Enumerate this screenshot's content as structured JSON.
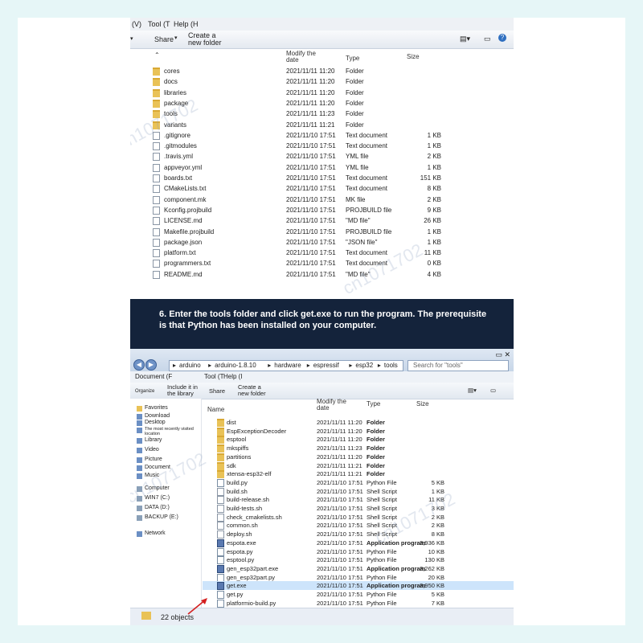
{
  "top_window": {
    "menu": [
      "(V)",
      "Tool (T",
      "Help (H"
    ],
    "toolbar": {
      "share": "Share",
      "new_folder": "Create a new folder"
    },
    "columns": {
      "modify": "Modify the date",
      "type": "Type",
      "size": "Size"
    },
    "files": [
      {
        "name": "cores",
        "date": "2021/11/11 11:20",
        "type": "Folder",
        "size": "",
        "icon": "folder"
      },
      {
        "name": "docs",
        "date": "2021/11/11 11:20",
        "type": "Folder",
        "size": "",
        "icon": "folder"
      },
      {
        "name": "libraries",
        "date": "2021/11/11 11:20",
        "type": "Folder",
        "size": "",
        "icon": "folder"
      },
      {
        "name": "package",
        "date": "2021/11/11 11:20",
        "type": "Folder",
        "size": "",
        "icon": "folder"
      },
      {
        "name": "tools",
        "date": "2021/11/11 11:23",
        "type": "Folder",
        "size": "",
        "icon": "folder"
      },
      {
        "name": "variants",
        "date": "2021/11/11 11:21",
        "type": "Folder",
        "size": "",
        "icon": "folder"
      },
      {
        "name": ".gitignore",
        "date": "2021/11/10 17:51",
        "type": "Text document",
        "size": "1 KB",
        "icon": "file"
      },
      {
        "name": ".gitmodules",
        "date": "2021/11/10 17:51",
        "type": "Text document",
        "size": "1 KB",
        "icon": "file"
      },
      {
        "name": ".travis.yml",
        "date": "2021/11/10 17:51",
        "type": "YML file",
        "size": "2 KB",
        "icon": "file"
      },
      {
        "name": "appveyor.yml",
        "date": "2021/11/10 17:51",
        "type": "YML file",
        "size": "1 KB",
        "icon": "file"
      },
      {
        "name": "boards.txt",
        "date": "2021/11/10 17:51",
        "type": "Text document",
        "size": "151 KB",
        "icon": "file"
      },
      {
        "name": "CMakeLists.txt",
        "date": "2021/11/10 17:51",
        "type": "Text document",
        "size": "8 KB",
        "icon": "file"
      },
      {
        "name": "component.mk",
        "date": "2021/11/10 17:51",
        "type": "MK file",
        "size": "2 KB",
        "icon": "file"
      },
      {
        "name": "Kconfig.projbuild",
        "date": "2021/11/10 17:51",
        "type": "PROJBUILD file",
        "size": "9 KB",
        "icon": "file"
      },
      {
        "name": "LICENSE.md",
        "date": "2021/11/10 17:51",
        "type": "\"MD file\"",
        "size": "26 KB",
        "icon": "file"
      },
      {
        "name": "Makefile.projbuild",
        "date": "2021/11/10 17:51",
        "type": "PROJBUILD file",
        "size": "1 KB",
        "icon": "file"
      },
      {
        "name": "package.json",
        "date": "2021/11/10 17:51",
        "type": "\"JSON file\"",
        "size": "1 KB",
        "icon": "file"
      },
      {
        "name": "platform.txt",
        "date": "2021/11/10 17:51",
        "type": "Text document",
        "size": "11 KB",
        "icon": "file"
      },
      {
        "name": "programmers.txt",
        "date": "2021/11/10 17:51",
        "type": "Text document",
        "size": "0 KB",
        "icon": "file"
      },
      {
        "name": "README.md",
        "date": "2021/11/10 17:51",
        "type": "\"MD file\"",
        "size": "4 KB",
        "icon": "file"
      }
    ]
  },
  "banner": {
    "text": "6. Enter the tools folder and click get.exe to run the program. The prerequisite is that Python has been installed on your computer."
  },
  "bottom_window": {
    "path": [
      "arduino",
      "arduino-1.8.10",
      "hardware",
      "espressif",
      "esp32",
      "tools"
    ],
    "search_placeholder": "Search for \"tools\"",
    "menu": [
      "Document (F",
      "Tool (T",
      "Help (I"
    ],
    "toolbar": {
      "organize": "Organize",
      "include": "Include it in the library",
      "share": "Share",
      "new_folder": "Create a new folder"
    },
    "columns": {
      "name": "Name",
      "modify": "Modify the date",
      "type": "Type",
      "size": "Size"
    },
    "nav": [
      "Favorites",
      "Download",
      "Desktop",
      "The most recently visited location",
      "Library",
      "Video",
      "Picture",
      "Document",
      "Music",
      "Computer",
      "WIN7 (C:)",
      "DATA (D:)",
      "BACKUP (E:)",
      "Network"
    ],
    "files": [
      {
        "name": "dist",
        "date": "2021/11/11 11:20",
        "type": "Folder",
        "size": "",
        "icon": "folder"
      },
      {
        "name": "EspExceptionDecoder",
        "date": "2021/11/11 11:20",
        "type": "Folder",
        "size": "",
        "icon": "folder"
      },
      {
        "name": "esptool",
        "date": "2021/11/11 11:20",
        "type": "Folder",
        "size": "",
        "icon": "folder"
      },
      {
        "name": "mkspiffs",
        "date": "2021/11/11 11:23",
        "type": "Folder",
        "size": "",
        "icon": "folder"
      },
      {
        "name": "partitions",
        "date": "2021/11/11 11:20",
        "type": "Folder",
        "size": "",
        "icon": "folder"
      },
      {
        "name": "sdk",
        "date": "2021/11/11 11:21",
        "type": "Folder",
        "size": "",
        "icon": "folder"
      },
      {
        "name": "xtensa-esp32-elf",
        "date": "2021/11/11 11:21",
        "type": "Folder",
        "size": "",
        "icon": "folder"
      },
      {
        "name": "build.py",
        "date": "2021/11/10 17:51",
        "type": "Python File",
        "size": "5 KB",
        "icon": "py"
      },
      {
        "name": "build.sh",
        "date": "2021/11/10 17:51",
        "type": "Shell Script",
        "size": "1 KB",
        "icon": "file"
      },
      {
        "name": "build-release.sh",
        "date": "2021/11/10 17:51",
        "type": "Shell Script",
        "size": "11 KB",
        "icon": "file"
      },
      {
        "name": "build-tests.sh",
        "date": "2021/11/10 17:51",
        "type": "Shell Script",
        "size": "3 KB",
        "icon": "file"
      },
      {
        "name": "check_cmakelists.sh",
        "date": "2021/11/10 17:51",
        "type": "Shell Script",
        "size": "2 KB",
        "icon": "file"
      },
      {
        "name": "common.sh",
        "date": "2021/11/10 17:51",
        "type": "Shell Script",
        "size": "2 KB",
        "icon": "file"
      },
      {
        "name": "deploy.sh",
        "date": "2021/11/10 17:51",
        "type": "Shell Script",
        "size": "8 KB",
        "icon": "file"
      },
      {
        "name": "espota.exe",
        "date": "2021/11/10 17:51",
        "type": "Application program",
        "size": "3,936 KB",
        "icon": "exe"
      },
      {
        "name": "espota.py",
        "date": "2021/11/10 17:51",
        "type": "Python File",
        "size": "10 KB",
        "icon": "py"
      },
      {
        "name": "esptool.py",
        "date": "2021/11/10 17:51",
        "type": "Python File",
        "size": "130 KB",
        "icon": "py"
      },
      {
        "name": "gen_esp32part.exe",
        "date": "2021/11/10 17:51",
        "type": "Application program",
        "size": "3,262 KB",
        "icon": "exe"
      },
      {
        "name": "gen_esp32part.py",
        "date": "2021/11/10 17:51",
        "type": "Python File",
        "size": "20 KB",
        "icon": "py"
      },
      {
        "name": "get.exe",
        "date": "2021/11/10 17:51",
        "type": "Application program",
        "size": "3,950 KB",
        "icon": "exe"
      },
      {
        "name": "get.py",
        "date": "2021/11/10 17:51",
        "type": "Python File",
        "size": "5 KB",
        "icon": "py"
      },
      {
        "name": "platformio-build.py",
        "date": "2021/11/10 17:51",
        "type": "Python File",
        "size": "7 KB",
        "icon": "py"
      }
    ],
    "selected": "get.exe",
    "status": "22 objects"
  },
  "watermark": "cn1071702"
}
